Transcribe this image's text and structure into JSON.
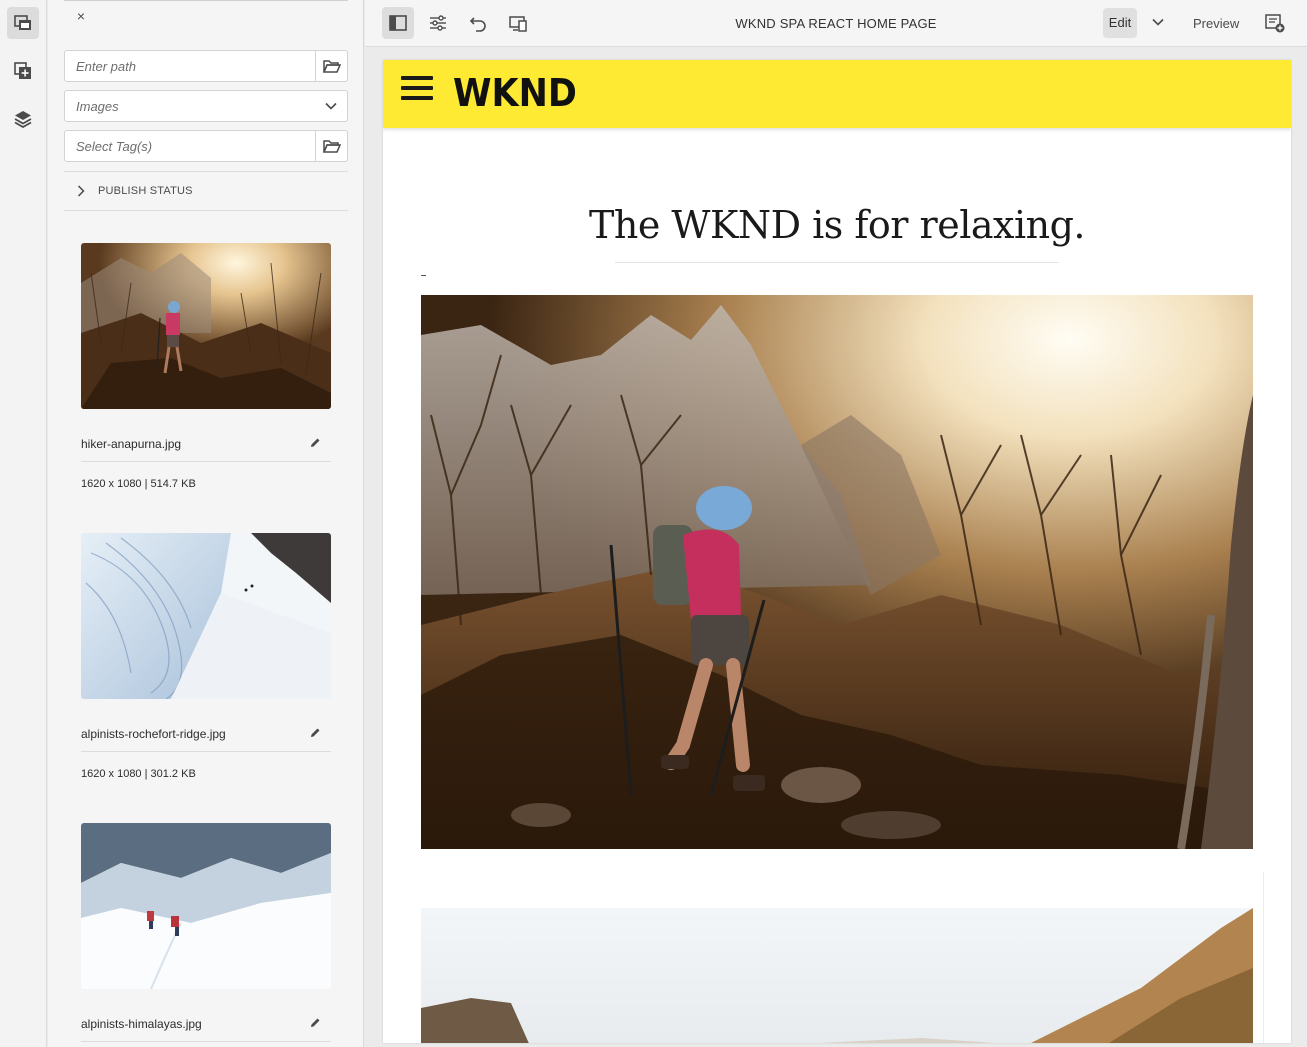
{
  "rail": {
    "items": [
      {
        "icon": "assets-icon",
        "active": true
      },
      {
        "icon": "components-icon",
        "active": false
      },
      {
        "icon": "layers-icon",
        "active": false
      }
    ]
  },
  "panel": {
    "close_label": "×",
    "path_placeholder": "Enter path",
    "asset_type": "Images",
    "tags_placeholder": "Select Tag(s)",
    "publish_status_label": "PUBLISH STATUS",
    "assets": [
      {
        "name": "hiker-anapurna.jpg",
        "meta": "1620 x 1080 | 514.7 KB"
      },
      {
        "name": "alpinists-rochefort-ridge.jpg",
        "meta": "1620 x 1080 | 301.2 KB"
      },
      {
        "name": "alpinists-himalayas.jpg",
        "meta": ""
      }
    ]
  },
  "toolbar": {
    "page_title": "WKND SPA REACT HOME PAGE",
    "edit_label": "Edit",
    "preview_label": "Preview"
  },
  "page": {
    "logo": "WKND",
    "hero_title": "The WKND is for relaxing."
  },
  "colors": {
    "header_yellow": "#ffea33",
    "panel_bg": "#f5f5f5",
    "toolbar_bg": "#f5f5f5"
  }
}
